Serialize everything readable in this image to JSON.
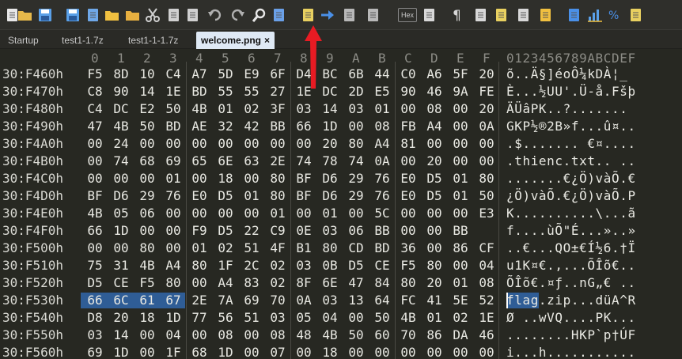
{
  "toolbar": {
    "icons": [
      "new-file-icon",
      "open-folder-icon",
      "save-icon",
      "save-all-icon",
      "copy-files-icon",
      "folder-icon",
      "folders-icon",
      "cut-icon",
      "copy-icon",
      "paste-icon",
      "undo-icon",
      "redo-icon",
      "find-icon",
      "replace-icon",
      "find-in-files-icon",
      "goto-icon",
      "docs-icon",
      "docs2-icon",
      "hex-mode-icon",
      "format-icon",
      "pilcrow-icon",
      "columns-icon",
      "marker-icon",
      "box-icon",
      "window-icon",
      "image-icon",
      "chart-icon",
      "math-icon",
      "extra-icon"
    ],
    "hex_label": "Hex"
  },
  "tabs": [
    {
      "label": "Startup",
      "active": false
    },
    {
      "label": "test1-1.7z",
      "active": false
    },
    {
      "label": "test1-1-1.7z",
      "active": false
    },
    {
      "label": "welcome.png",
      "active": true,
      "close": "×"
    }
  ],
  "hex": {
    "columns": [
      "0",
      "1",
      "2",
      "3",
      "4",
      "5",
      "6",
      "7",
      "8",
      "9",
      "A",
      "B",
      "C",
      "D",
      "E",
      "F"
    ],
    "ascii_header": "0123456789ABCDEF",
    "rows": [
      {
        "addr": "30:F460h",
        "bytes": [
          "F5",
          "8D",
          "10",
          "C4",
          "A7",
          "5D",
          "E9",
          "6F",
          "D4",
          "BC",
          "6B",
          "44",
          "C0",
          "A6",
          "5F",
          "20"
        ],
        "ascii": "õ..Ä§]éoÔ¼kDÀ¦_ "
      },
      {
        "addr": "30:F470h",
        "bytes": [
          "C8",
          "90",
          "14",
          "1E",
          "BD",
          "55",
          "55",
          "27",
          "1E",
          "DC",
          "2D",
          "E5",
          "90",
          "46",
          "9A",
          "FE"
        ],
        "ascii": "È...½UU'.Ü-å.Fšþ"
      },
      {
        "addr": "30:F480h",
        "bytes": [
          "C4",
          "DC",
          "E2",
          "50",
          "4B",
          "01",
          "02",
          "3F",
          "03",
          "14",
          "03",
          "01",
          "00",
          "08",
          "00",
          "20"
        ],
        "ascii": "ÄÜâPK..?....... "
      },
      {
        "addr": "30:F490h",
        "bytes": [
          "47",
          "4B",
          "50",
          "BD",
          "AE",
          "32",
          "42",
          "BB",
          "66",
          "1D",
          "00",
          "08",
          "FB",
          "A4",
          "00",
          "0A"
        ],
        "ascii": "GKP½®2B»f...û¤.."
      },
      {
        "addr": "30:F4A0h",
        "bytes": [
          "00",
          "24",
          "00",
          "00",
          "00",
          "00",
          "00",
          "00",
          "00",
          "20",
          "80",
          "A4",
          "81",
          "00",
          "00",
          "00"
        ],
        "ascii": ".$....... €¤...."
      },
      {
        "addr": "30:F4B0h",
        "bytes": [
          "00",
          "74",
          "68",
          "69",
          "65",
          "6E",
          "63",
          "2E",
          "74",
          "78",
          "74",
          "0A",
          "00",
          "20",
          "00",
          "00"
        ],
        "ascii": ".thienc.txt.. .."
      },
      {
        "addr": "30:F4C0h",
        "bytes": [
          "00",
          "00",
          "00",
          "01",
          "00",
          "18",
          "00",
          "80",
          "BF",
          "D6",
          "29",
          "76",
          "E0",
          "D5",
          "01",
          "80"
        ],
        "ascii": ".......€¿Ö)vàÕ.€"
      },
      {
        "addr": "30:F4D0h",
        "bytes": [
          "BF",
          "D6",
          "29",
          "76",
          "E0",
          "D5",
          "01",
          "80",
          "BF",
          "D6",
          "29",
          "76",
          "E0",
          "D5",
          "01",
          "50"
        ],
        "ascii": "¿Ö)vàÕ.€¿Ö)vàÕ.P"
      },
      {
        "addr": "30:F4E0h",
        "bytes": [
          "4B",
          "05",
          "06",
          "00",
          "00",
          "00",
          "00",
          "01",
          "00",
          "01",
          "00",
          "5C",
          "00",
          "00",
          "00",
          "E3"
        ],
        "ascii": "K..........\\...ã"
      },
      {
        "addr": "30:F4F0h",
        "bytes": [
          "66",
          "1D",
          "00",
          "00",
          "F9",
          "D5",
          "22",
          "C9",
          "0E",
          "03",
          "06",
          "BB",
          "00",
          "00",
          "BB"
        ],
        "ascii": "f....ùÕ\"É...»..»"
      },
      {
        "addr": "30:F500h",
        "bytes": [
          "00",
          "00",
          "80",
          "00",
          "01",
          "02",
          "51",
          "4F",
          "B1",
          "80",
          "CD",
          "BD",
          "36",
          "00",
          "86",
          "CF"
        ],
        "ascii": "..€...QO±€Í½6.†Ï"
      },
      {
        "addr": "30:F510h",
        "bytes": [
          "75",
          "31",
          "4B",
          "A4",
          "80",
          "1F",
          "2C",
          "02",
          "03",
          "0B",
          "D5",
          "CE",
          "F5",
          "80",
          "00",
          "04"
        ],
        "ascii": "u1K¤€.,...ÕÎõ€.."
      },
      {
        "addr": "30:F520h",
        "bytes": [
          "D5",
          "CE",
          "F5",
          "80",
          "00",
          "A4",
          "83",
          "02",
          "8F",
          "6E",
          "47",
          "84",
          "80",
          "20",
          "01",
          "08"
        ],
        "ascii": "ÕÎõ€.¤ƒ..nG„€ .."
      },
      {
        "addr": "30:F530h",
        "bytes": [
          "66",
          "6C",
          "61",
          "67",
          "2E",
          "7A",
          "69",
          "70",
          "0A",
          "03",
          "13",
          "64",
          "FC",
          "41",
          "5E",
          "52"
        ],
        "ascii": "flag.zip...düA^R"
      },
      {
        "addr": "30:F540h",
        "bytes": [
          "D8",
          "20",
          "18",
          "1D",
          "77",
          "56",
          "51",
          "03",
          "05",
          "04",
          "00",
          "50",
          "4B",
          "01",
          "02",
          "1E"
        ],
        "ascii": "Ø ..wVQ....PK..."
      },
      {
        "addr": "30:F550h",
        "bytes": [
          "03",
          "14",
          "00",
          "04",
          "00",
          "08",
          "00",
          "08",
          "48",
          "4B",
          "50",
          "60",
          "70",
          "86",
          "DA",
          "46"
        ],
        "ascii": "........HKP`p†ÚF"
      },
      {
        "addr": "30:F560h",
        "bytes": [
          "69",
          "1D",
          "00",
          "1F",
          "68",
          "1D",
          "00",
          "07",
          "00",
          "18",
          "00",
          "00",
          "00",
          "00",
          "00",
          "00"
        ],
        "ascii": "i...h..........."
      }
    ],
    "selection": {
      "row": 13,
      "from": 0,
      "to": 3
    }
  }
}
